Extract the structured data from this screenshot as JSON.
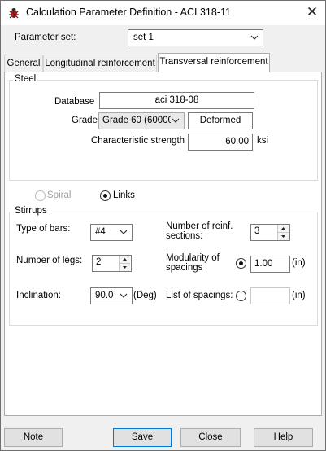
{
  "window": {
    "title": "Calculation Parameter Definition - ACI 318-11",
    "close_glyph": "✕",
    "app_icon": "bug-icon"
  },
  "parameter_set": {
    "label": "Parameter set:",
    "value": "set 1"
  },
  "tabs": [
    {
      "label": "General",
      "active": false
    },
    {
      "label": "Longitudinal reinforcement",
      "active": false
    },
    {
      "label": "Transversal reinforcement",
      "active": true
    }
  ],
  "steel": {
    "title": "Steel",
    "database_label": "Database",
    "database_value": "aci 318-08",
    "grade_label": "Grade",
    "grade_value": "Grade 60 (60000",
    "grade_type": "Deformed",
    "strength_label": "Characteristic strength",
    "strength_value": "60.00",
    "strength_unit": "ksi"
  },
  "shape": {
    "spiral_label": "Spiral",
    "spiral_selected": false,
    "spiral_enabled": false,
    "links_label": "Links",
    "links_selected": true
  },
  "stirrups": {
    "title": "Stirrups",
    "type_label": "Type of bars:",
    "type_value": "#4",
    "sections_label_1": "Number of reinf.",
    "sections_label_2": "sections:",
    "sections_value": "3",
    "legs_label": "Number of legs:",
    "legs_value": "2",
    "modularity_label_1": "Modularity of",
    "modularity_label_2": "spacings",
    "modularity_selected": true,
    "modularity_value": "1.00",
    "modularity_unit": "(in)",
    "inclination_label": "Inclination:",
    "inclination_value": "90.0",
    "inclination_unit": "(Deg)",
    "list_label": "List of spacings:",
    "list_selected": false,
    "list_value": "",
    "list_unit": "(in)"
  },
  "buttons": {
    "note": "Note",
    "save": "Save",
    "close": "Close",
    "help": "Help"
  }
}
